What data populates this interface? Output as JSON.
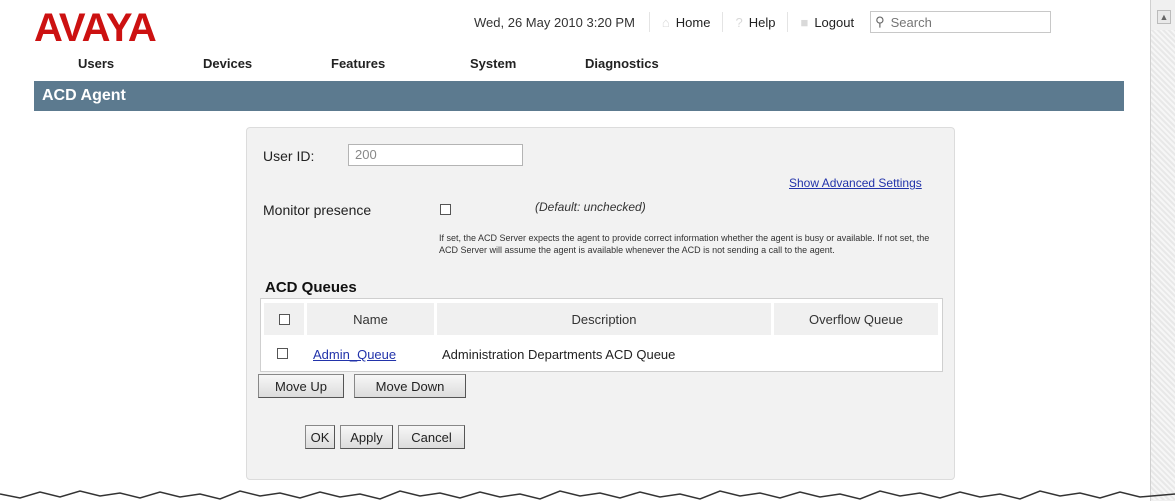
{
  "brand": "AVAYA",
  "header": {
    "datetime": "Wed, 26 May 2010 3:20 PM",
    "home": "Home",
    "help": "Help",
    "logout": "Logout",
    "search_placeholder": "Search"
  },
  "nav": {
    "items": [
      "Users",
      "Devices",
      "Features",
      "System",
      "Diagnostics"
    ]
  },
  "page_title": "ACD Agent",
  "form": {
    "user_id_label": "User ID:",
    "user_id_value": "200",
    "show_advanced": "Show Advanced Settings",
    "monitor_label": "Monitor presence",
    "monitor_checked": false,
    "monitor_default": "(Default: unchecked)",
    "monitor_help": "If set, the ACD Server expects the agent to provide correct information whether the agent is busy or available. If not set, the ACD Server will assume the agent is available whenever the ACD is not sending a call to the agent."
  },
  "queues": {
    "heading": "ACD Queues",
    "columns": [
      "Name",
      "Description",
      "Overflow Queue"
    ],
    "rows": [
      {
        "name": "Admin_Queue",
        "description": "Administration Departments ACD Queue",
        "overflow": ""
      }
    ]
  },
  "buttons": {
    "move_up": "Move Up",
    "move_down": "Move Down",
    "ok": "OK",
    "apply": "Apply",
    "cancel": "Cancel"
  }
}
